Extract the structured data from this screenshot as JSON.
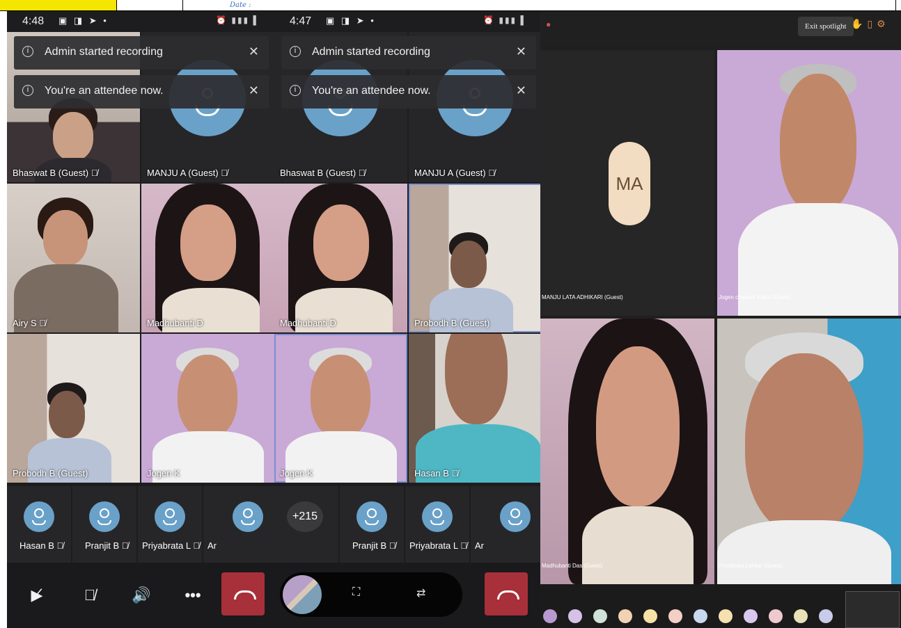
{
  "header_strip": {
    "date_label": "Date :"
  },
  "phone1": {
    "status_time": "4:48",
    "banners": [
      {
        "text": "Admin started recording"
      },
      {
        "text": "You're an attendee now."
      }
    ],
    "tiles": [
      {
        "name": "Bhaswat B (Guest)"
      },
      {
        "name": "MANJU A (Guest)"
      },
      {
        "name": "Airy S"
      },
      {
        "name": "Madhubanti D"
      },
      {
        "name": "Probodh B (Guest)"
      },
      {
        "name": "Jogen K"
      }
    ],
    "strip": [
      {
        "name": "Hasan B"
      },
      {
        "name": "Pranjit B"
      },
      {
        "name": "Priyabrata L"
      },
      {
        "name": "Ar"
      }
    ]
  },
  "phone2": {
    "status_time": "4:47",
    "banners": [
      {
        "text": "Admin started recording"
      },
      {
        "text": "You're an attendee now."
      }
    ],
    "tiles": [
      {
        "name": "Bhaswat B (Guest)"
      },
      {
        "name": "MANJU A (Guest)"
      },
      {
        "name": "Madhubanti D"
      },
      {
        "name": "Probodh B (Guest)"
      },
      {
        "name": "Jogen K"
      },
      {
        "name": "Hasan B"
      }
    ],
    "overflow_count": "+215",
    "strip": [
      {
        "name": "Pranjit B"
      },
      {
        "name": "Priyabrata L"
      },
      {
        "name": "Ar"
      }
    ]
  },
  "desktop": {
    "exit_spotlight_label": "Exit spotlight",
    "avatar_initials": "MA",
    "tiles": [
      {
        "name": "MANJU LATA ADHIKARI (Guest)"
      },
      {
        "name": "Jogen chandra Kalita (Guest)"
      },
      {
        "name": "Madhubanti Das (Guest)"
      },
      {
        "name": "Priyabrata Lahkar (Guest)"
      }
    ]
  },
  "colors": {
    "phone_bg": "#1d1d1f",
    "avatar_blue": "#6aa1c9",
    "end_call_red": "#a8303a",
    "selection_outline": "#7b8fd1",
    "wall_lilac": "#c9a9d6"
  },
  "icons": [
    "info-icon",
    "close-icon",
    "mic-muted-icon",
    "camera-off-icon",
    "speaker-icon",
    "more-icon",
    "end-call-icon",
    "switch-camera-icon",
    "screen-share-icon"
  ]
}
